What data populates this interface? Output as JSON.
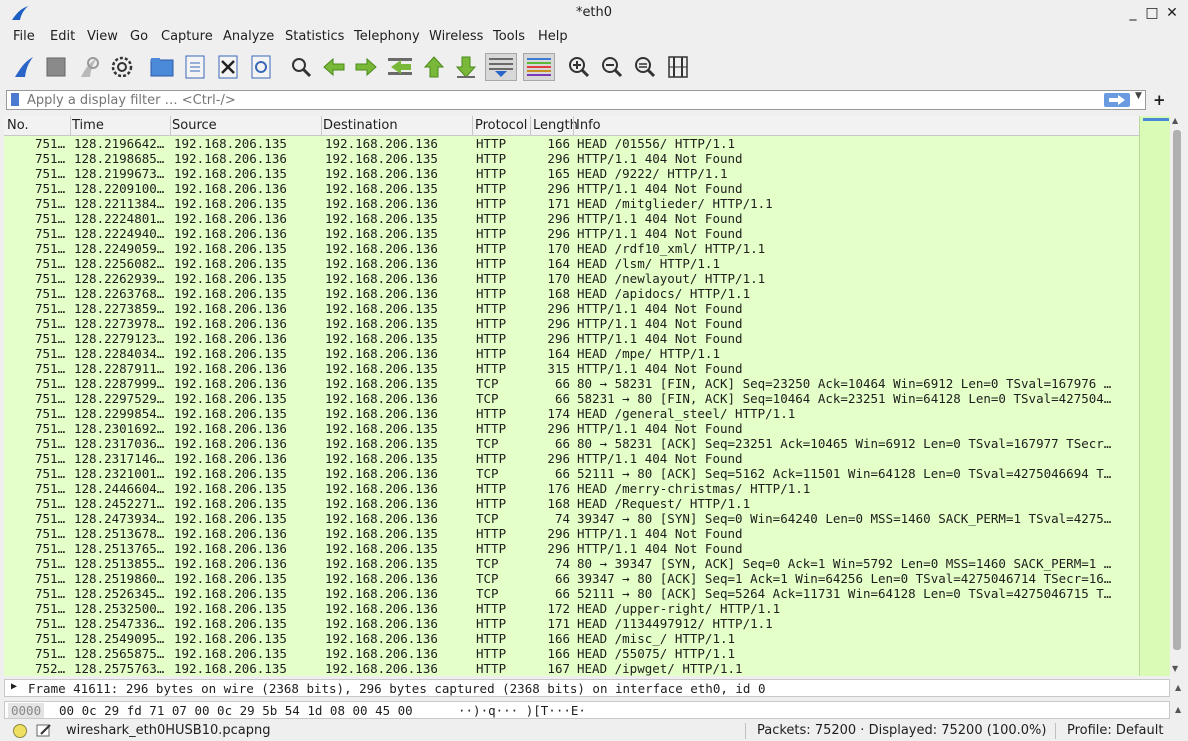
{
  "window": {
    "title": "*eth0",
    "minimize": "_",
    "maximize": "□",
    "close": "✕"
  },
  "menu": [
    {
      "label": "File"
    },
    {
      "label": "Edit"
    },
    {
      "label": "View"
    },
    {
      "label": "Go"
    },
    {
      "label": "Capture"
    },
    {
      "label": "Analyze"
    },
    {
      "label": "Statistics"
    },
    {
      "label": "Telephony"
    },
    {
      "label": "Wireless"
    },
    {
      "label": "Tools"
    },
    {
      "label": "Help"
    }
  ],
  "toolbar": [
    "shark-fin-start-icon",
    "stop-capture-icon",
    "restart-capture-icon",
    "capture-options-icon",
    "open-file-icon",
    "save-file-icon",
    "close-file-icon",
    "reload-file-icon",
    "find-packet-icon",
    "go-back-icon",
    "go-forward-icon",
    "go-to-packet-icon",
    "go-first-icon",
    "go-last-icon",
    "auto-scroll-icon",
    "colorize-icon",
    "zoom-in-icon",
    "zoom-out-icon",
    "zoom-normal-icon",
    "resize-columns-icon"
  ],
  "filter": {
    "placeholder": "Apply a display filter … <Ctrl-/>"
  },
  "columns": {
    "no": "No.",
    "time": "Time",
    "source": "Source",
    "destination": "Destination",
    "protocol": "Protocol",
    "length": "Length",
    "info": "Info"
  },
  "packets": [
    {
      "no": "751…",
      "time": "128.2196642…",
      "src": "192.168.206.135",
      "dst": "192.168.206.136",
      "proto": "HTTP",
      "len": "166",
      "info": "HEAD /01556/ HTTP/1.1"
    },
    {
      "no": "751…",
      "time": "128.2198685…",
      "src": "192.168.206.136",
      "dst": "192.168.206.135",
      "proto": "HTTP",
      "len": "296",
      "info": "HTTP/1.1 404 Not Found"
    },
    {
      "no": "751…",
      "time": "128.2199673…",
      "src": "192.168.206.135",
      "dst": "192.168.206.136",
      "proto": "HTTP",
      "len": "165",
      "info": "HEAD /9222/ HTTP/1.1"
    },
    {
      "no": "751…",
      "time": "128.2209100…",
      "src": "192.168.206.136",
      "dst": "192.168.206.135",
      "proto": "HTTP",
      "len": "296",
      "info": "HTTP/1.1 404 Not Found"
    },
    {
      "no": "751…",
      "time": "128.2211384…",
      "src": "192.168.206.135",
      "dst": "192.168.206.136",
      "proto": "HTTP",
      "len": "171",
      "info": "HEAD /mitglieder/ HTTP/1.1"
    },
    {
      "no": "751…",
      "time": "128.2224801…",
      "src": "192.168.206.136",
      "dst": "192.168.206.135",
      "proto": "HTTP",
      "len": "296",
      "info": "HTTP/1.1 404 Not Found"
    },
    {
      "no": "751…",
      "time": "128.2224940…",
      "src": "192.168.206.136",
      "dst": "192.168.206.135",
      "proto": "HTTP",
      "len": "296",
      "info": "HTTP/1.1 404 Not Found"
    },
    {
      "no": "751…",
      "time": "128.2249059…",
      "src": "192.168.206.135",
      "dst": "192.168.206.136",
      "proto": "HTTP",
      "len": "170",
      "info": "HEAD /rdf10_xml/ HTTP/1.1"
    },
    {
      "no": "751…",
      "time": "128.2256082…",
      "src": "192.168.206.135",
      "dst": "192.168.206.136",
      "proto": "HTTP",
      "len": "164",
      "info": "HEAD /lsm/ HTTP/1.1"
    },
    {
      "no": "751…",
      "time": "128.2262939…",
      "src": "192.168.206.135",
      "dst": "192.168.206.136",
      "proto": "HTTP",
      "len": "170",
      "info": "HEAD /newlayout/ HTTP/1.1"
    },
    {
      "no": "751…",
      "time": "128.2263768…",
      "src": "192.168.206.135",
      "dst": "192.168.206.136",
      "proto": "HTTP",
      "len": "168",
      "info": "HEAD /apidocs/ HTTP/1.1"
    },
    {
      "no": "751…",
      "time": "128.2273859…",
      "src": "192.168.206.136",
      "dst": "192.168.206.135",
      "proto": "HTTP",
      "len": "296",
      "info": "HTTP/1.1 404 Not Found"
    },
    {
      "no": "751…",
      "time": "128.2273978…",
      "src": "192.168.206.136",
      "dst": "192.168.206.135",
      "proto": "HTTP",
      "len": "296",
      "info": "HTTP/1.1 404 Not Found"
    },
    {
      "no": "751…",
      "time": "128.2279123…",
      "src": "192.168.206.136",
      "dst": "192.168.206.135",
      "proto": "HTTP",
      "len": "296",
      "info": "HTTP/1.1 404 Not Found"
    },
    {
      "no": "751…",
      "time": "128.2284034…",
      "src": "192.168.206.135",
      "dst": "192.168.206.136",
      "proto": "HTTP",
      "len": "164",
      "info": "HEAD /mpe/ HTTP/1.1"
    },
    {
      "no": "751…",
      "time": "128.2287911…",
      "src": "192.168.206.136",
      "dst": "192.168.206.135",
      "proto": "HTTP",
      "len": "315",
      "info": "HTTP/1.1 404 Not Found"
    },
    {
      "no": "751…",
      "time": "128.2287999…",
      "src": "192.168.206.136",
      "dst": "192.168.206.135",
      "proto": "TCP",
      "len": "66",
      "info": "80 → 58231 [FIN, ACK] Seq=23250 Ack=10464 Win=6912 Len=0 TSval=167976 …"
    },
    {
      "no": "751…",
      "time": "128.2297529…",
      "src": "192.168.206.135",
      "dst": "192.168.206.136",
      "proto": "TCP",
      "len": "66",
      "info": "58231 → 80 [FIN, ACK] Seq=10464 Ack=23251 Win=64128 Len=0 TSval=427504…"
    },
    {
      "no": "751…",
      "time": "128.2299854…",
      "src": "192.168.206.135",
      "dst": "192.168.206.136",
      "proto": "HTTP",
      "len": "174",
      "info": "HEAD /general_steel/ HTTP/1.1"
    },
    {
      "no": "751…",
      "time": "128.2301692…",
      "src": "192.168.206.136",
      "dst": "192.168.206.135",
      "proto": "HTTP",
      "len": "296",
      "info": "HTTP/1.1 404 Not Found"
    },
    {
      "no": "751…",
      "time": "128.2317036…",
      "src": "192.168.206.136",
      "dst": "192.168.206.135",
      "proto": "TCP",
      "len": "66",
      "info": "80 → 58231 [ACK] Seq=23251 Ack=10465 Win=6912 Len=0 TSval=167977 TSecr…"
    },
    {
      "no": "751…",
      "time": "128.2317146…",
      "src": "192.168.206.136",
      "dst": "192.168.206.135",
      "proto": "HTTP",
      "len": "296",
      "info": "HTTP/1.1 404 Not Found"
    },
    {
      "no": "751…",
      "time": "128.2321001…",
      "src": "192.168.206.135",
      "dst": "192.168.206.136",
      "proto": "TCP",
      "len": "66",
      "info": "52111 → 80 [ACK] Seq=5162 Ack=11501 Win=64128 Len=0 TSval=4275046694 T…"
    },
    {
      "no": "751…",
      "time": "128.2446604…",
      "src": "192.168.206.135",
      "dst": "192.168.206.136",
      "proto": "HTTP",
      "len": "176",
      "info": "HEAD /merry-christmas/ HTTP/1.1"
    },
    {
      "no": "751…",
      "time": "128.2452271…",
      "src": "192.168.206.135",
      "dst": "192.168.206.136",
      "proto": "HTTP",
      "len": "168",
      "info": "HEAD /Request/ HTTP/1.1"
    },
    {
      "no": "751…",
      "time": "128.2473934…",
      "src": "192.168.206.135",
      "dst": "192.168.206.136",
      "proto": "TCP",
      "len": "74",
      "info": "39347 → 80 [SYN] Seq=0 Win=64240 Len=0 MSS=1460 SACK_PERM=1 TSval=4275…"
    },
    {
      "no": "751…",
      "time": "128.2513678…",
      "src": "192.168.206.136",
      "dst": "192.168.206.135",
      "proto": "HTTP",
      "len": "296",
      "info": "HTTP/1.1 404 Not Found"
    },
    {
      "no": "751…",
      "time": "128.2513765…",
      "src": "192.168.206.136",
      "dst": "192.168.206.135",
      "proto": "HTTP",
      "len": "296",
      "info": "HTTP/1.1 404 Not Found"
    },
    {
      "no": "751…",
      "time": "128.2513855…",
      "src": "192.168.206.136",
      "dst": "192.168.206.135",
      "proto": "TCP",
      "len": "74",
      "info": "80 → 39347 [SYN, ACK] Seq=0 Ack=1 Win=5792 Len=0 MSS=1460 SACK_PERM=1 …"
    },
    {
      "no": "751…",
      "time": "128.2519860…",
      "src": "192.168.206.135",
      "dst": "192.168.206.136",
      "proto": "TCP",
      "len": "66",
      "info": "39347 → 80 [ACK] Seq=1 Ack=1 Win=64256 Len=0 TSval=4275046714 TSecr=16…"
    },
    {
      "no": "751…",
      "time": "128.2526345…",
      "src": "192.168.206.135",
      "dst": "192.168.206.136",
      "proto": "TCP",
      "len": "66",
      "info": "52111 → 80 [ACK] Seq=5264 Ack=11731 Win=64128 Len=0 TSval=4275046715 T…"
    },
    {
      "no": "751…",
      "time": "128.2532500…",
      "src": "192.168.206.135",
      "dst": "192.168.206.136",
      "proto": "HTTP",
      "len": "172",
      "info": "HEAD /upper-right/ HTTP/1.1"
    },
    {
      "no": "751…",
      "time": "128.2547336…",
      "src": "192.168.206.135",
      "dst": "192.168.206.136",
      "proto": "HTTP",
      "len": "171",
      "info": "HEAD /1134497912/ HTTP/1.1"
    },
    {
      "no": "751…",
      "time": "128.2549095…",
      "src": "192.168.206.135",
      "dst": "192.168.206.136",
      "proto": "HTTP",
      "len": "166",
      "info": "HEAD /misc_/ HTTP/1.1"
    },
    {
      "no": "751…",
      "time": "128.2565875…",
      "src": "192.168.206.135",
      "dst": "192.168.206.136",
      "proto": "HTTP",
      "len": "166",
      "info": "HEAD /55075/ HTTP/1.1"
    },
    {
      "no": "752…",
      "time": "128.2575763…",
      "src": "192.168.206.135",
      "dst": "192.168.206.136",
      "proto": "HTTP",
      "len": "167",
      "info": "HEAD /ipwget/ HTTP/1.1"
    }
  ],
  "detail": {
    "text": "Frame 41611: 296 bytes on wire (2368 bits), 296 bytes captured (2368 bits) on interface eth0, id 0"
  },
  "bytes": {
    "offset": "0000",
    "hex": "00 0c 29 fd 71 07 00 0c  29 5b 54 1d 08 00 45 00",
    "ascii": "··)·q··· )[T···E·"
  },
  "status": {
    "file": "wireshark_eth0HUSB10.pcapng",
    "packets": "Packets: 75200 · Displayed: 75200 (100.0%)",
    "profile": "Profile: Default"
  },
  "colors": {
    "http_row": "#e4ffc7",
    "accent": "#4a86d9"
  }
}
